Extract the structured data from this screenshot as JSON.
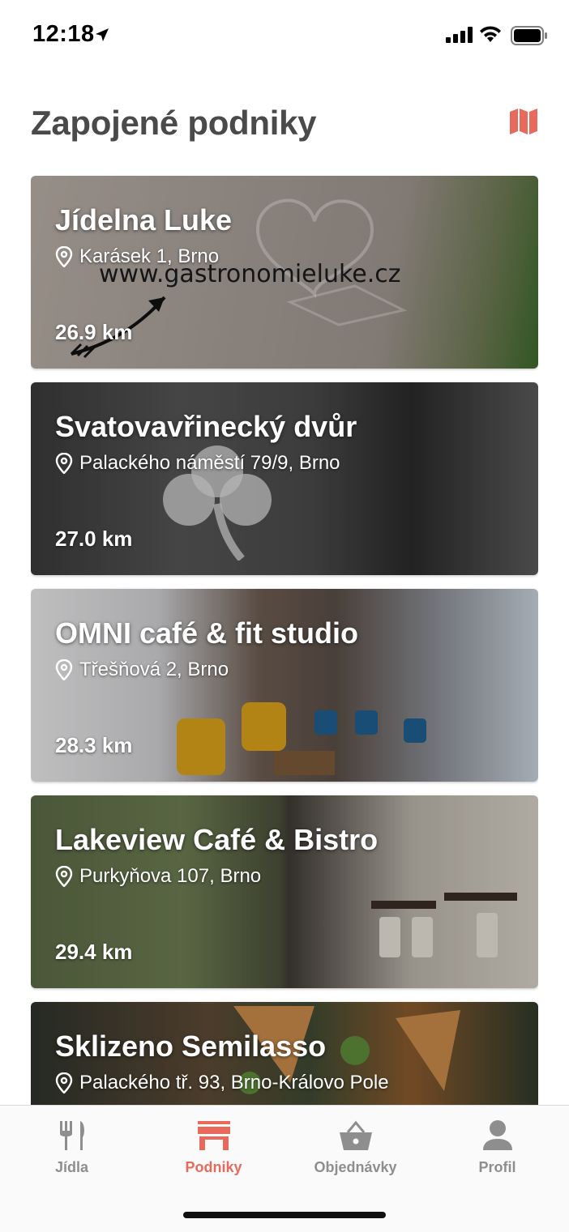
{
  "status_bar": {
    "time": "12:18"
  },
  "header": {
    "title": "Zapojené podniky",
    "map_icon": "map-icon"
  },
  "colors": {
    "accent": "#e76a5c",
    "title": "#4a4a4a",
    "inactive": "#8e8e8e"
  },
  "venues": [
    {
      "name": "Jídelna Luke",
      "address": "Karásek 1, Brno",
      "distance": "26.9 km",
      "image_text": "www.gastronomieluke.cz"
    },
    {
      "name": "Svatovavřinecký dvůr",
      "address": "Palackého náměstí 79/9, Brno",
      "distance": "27.0 km"
    },
    {
      "name": "OMNI café & fit studio",
      "address": "Třešňová 2, Brno",
      "distance": "28.3 km"
    },
    {
      "name": "Lakeview Café & Bistro",
      "address": "Purkyňova 107, Brno",
      "distance": "29.4 km"
    },
    {
      "name": "Sklizeno Semilasso",
      "address": "Palackého tř. 93, Brno-Královo Pole",
      "distance": ""
    }
  ],
  "tabs": [
    {
      "label": "Jídla",
      "icon": "fork-knife-icon",
      "active": false
    },
    {
      "label": "Podniky",
      "icon": "store-icon",
      "active": true
    },
    {
      "label": "Objednávky",
      "icon": "basket-icon",
      "active": false
    },
    {
      "label": "Profil",
      "icon": "person-icon",
      "active": false
    }
  ]
}
